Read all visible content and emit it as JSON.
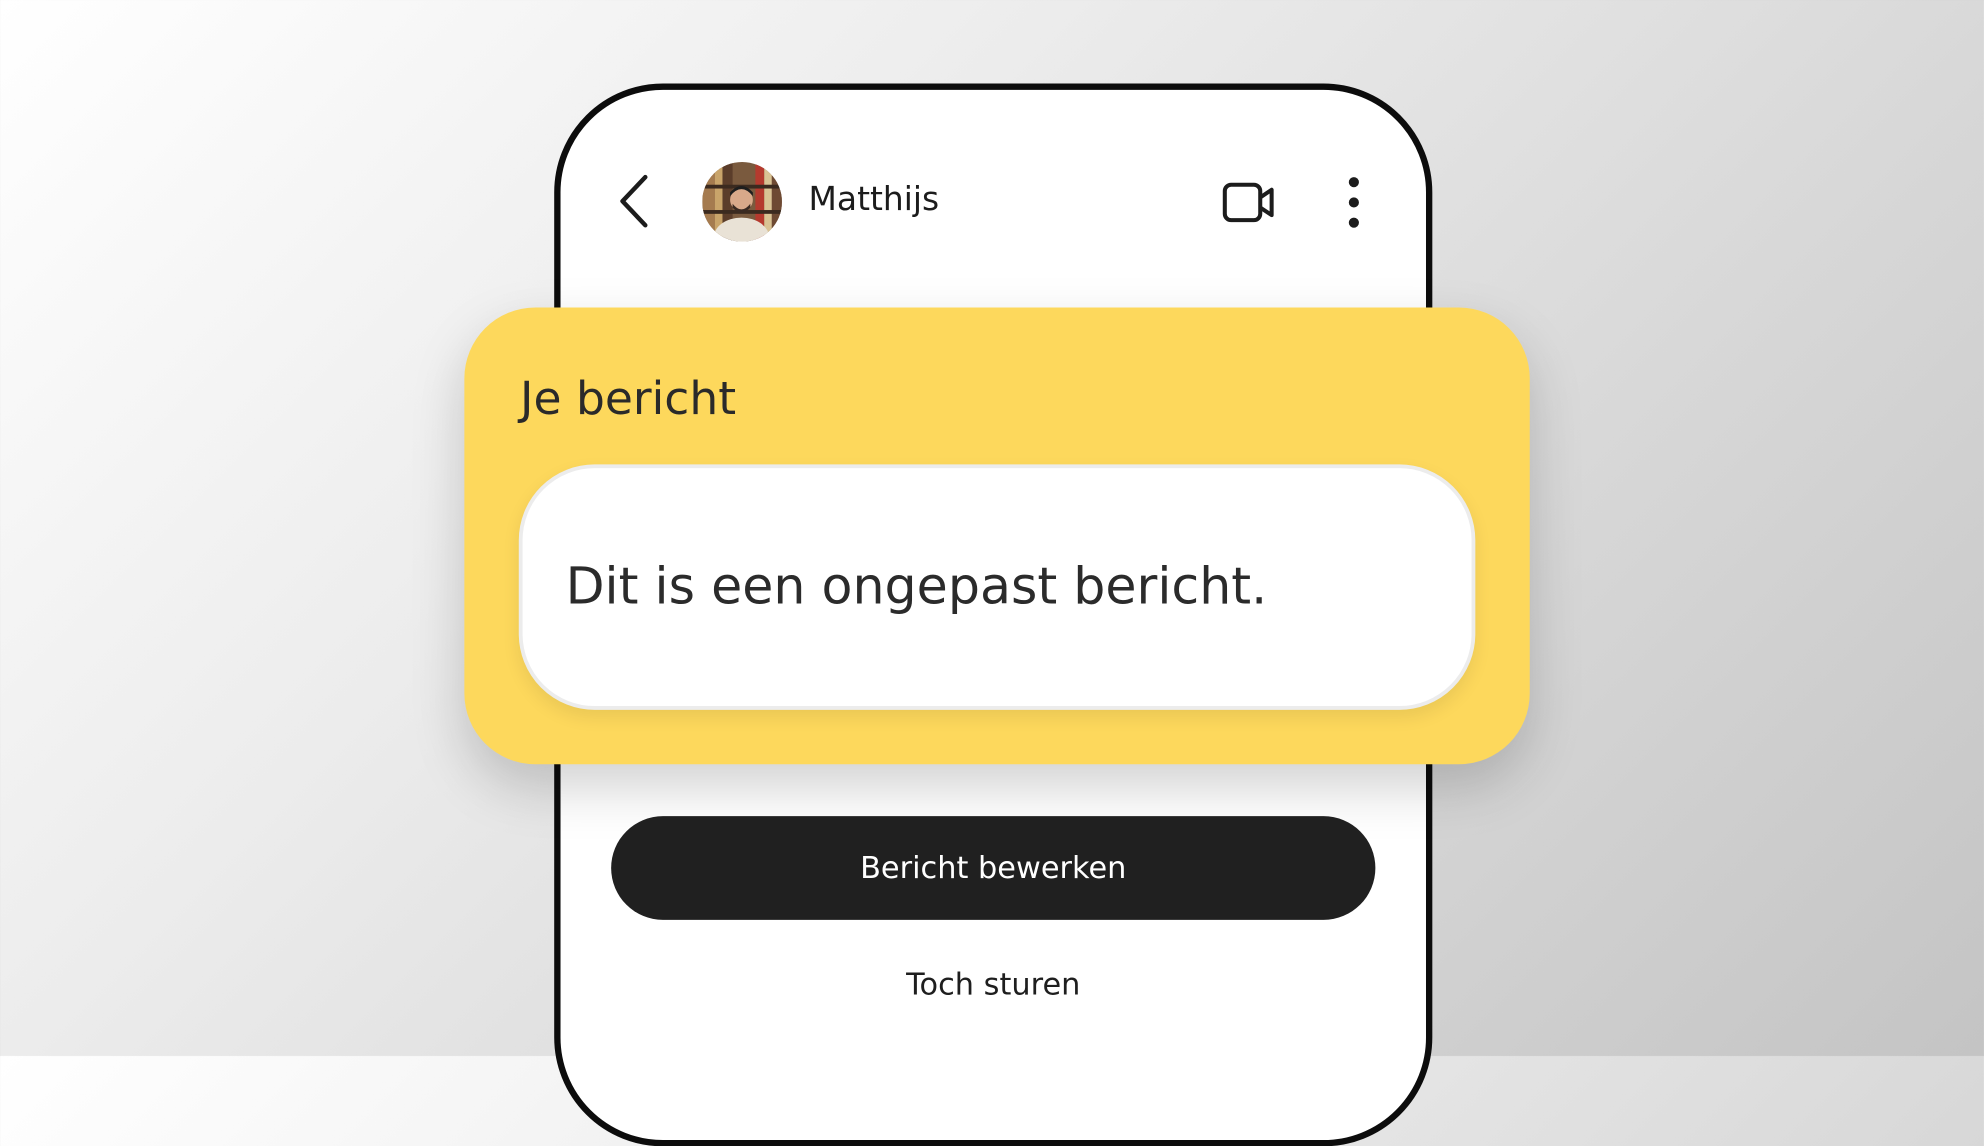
{
  "header": {
    "contact_name": "Matthijs",
    "icons": [
      "back-arrow-icon",
      "avatar",
      "video-call-icon",
      "more-vertical-icon"
    ]
  },
  "warning_card": {
    "heading": "Je bericht",
    "message": "Dit is een ongepast bericht.",
    "background_color": "#fdd85c"
  },
  "actions": {
    "edit_label": "Bericht bewerken",
    "send_anyway_label": "Toch sturen"
  }
}
